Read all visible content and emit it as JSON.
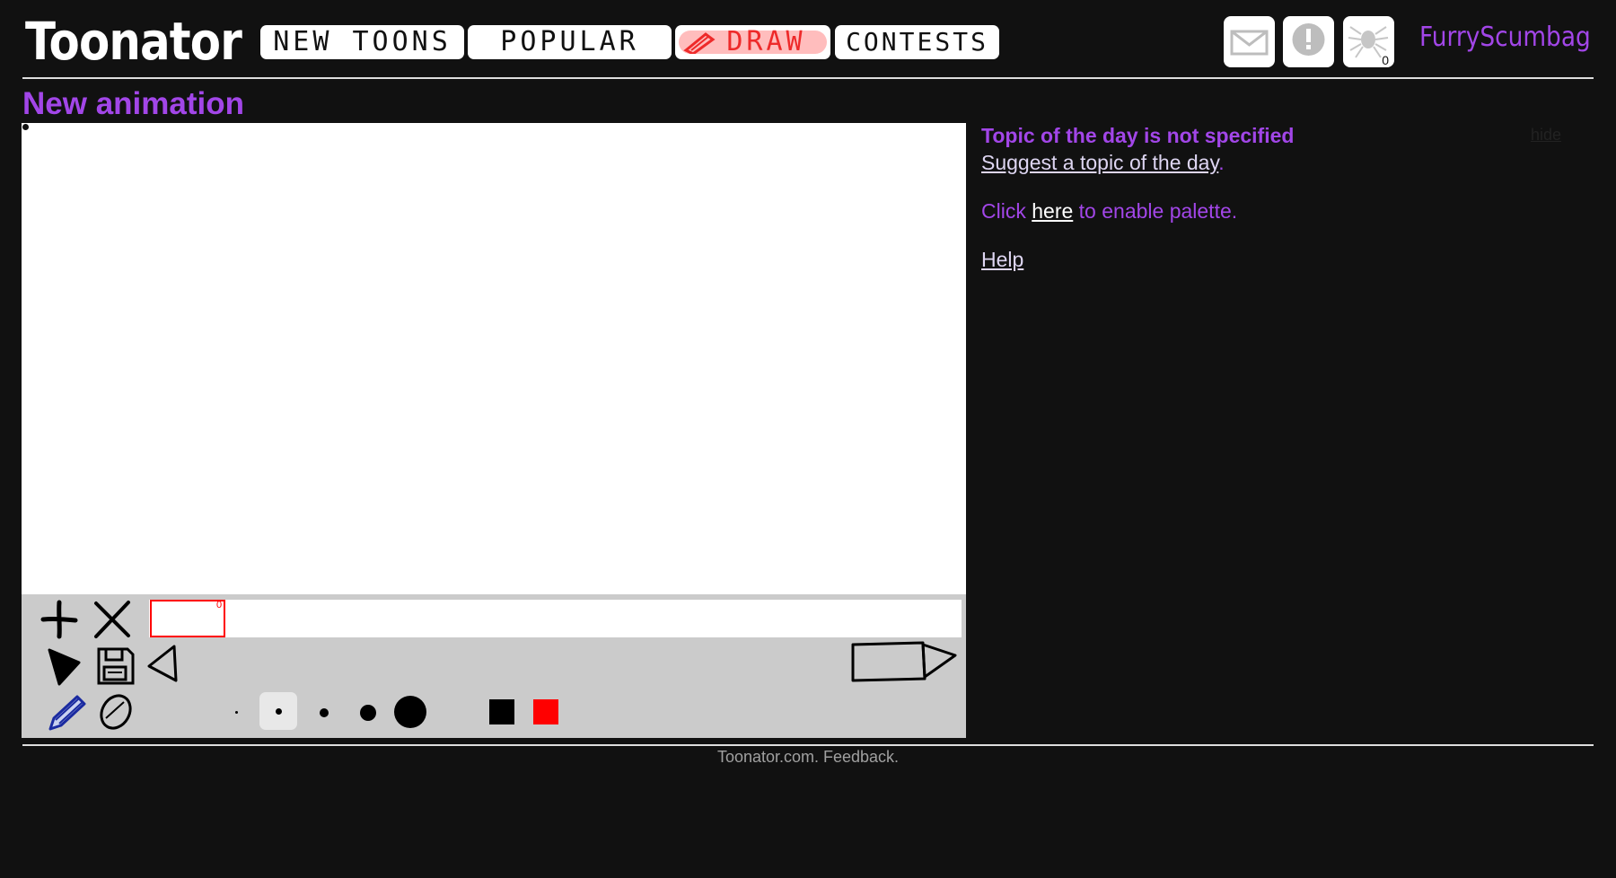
{
  "header": {
    "logo": "Toonator",
    "nav": [
      {
        "id": "new-toons",
        "label": "NEW TOONS"
      },
      {
        "id": "popular",
        "label": "POPULAR"
      },
      {
        "id": "draw",
        "label": "DRAW"
      },
      {
        "id": "contests",
        "label": "CONTESTS"
      }
    ],
    "icons": {
      "messages": "envelope-icon",
      "notifications": "exclamation-icon",
      "spider": "spider-icon",
      "spider_count": "0"
    },
    "username": "FurryScumbag"
  },
  "page": {
    "title": "New animation"
  },
  "editor": {
    "current_frame_number": "0",
    "brush_sizes": [
      "tiny",
      "small",
      "medium",
      "large",
      "huge"
    ],
    "selected_brush_size": "small",
    "colors": {
      "primary": "#000000",
      "secondary": "#ff0000"
    },
    "tools": [
      "add-frame-icon",
      "delete-frame-icon",
      "play-icon",
      "save-icon",
      "prev-frame-icon",
      "next-frame-icon",
      "pencil-icon",
      "eraser-icon"
    ]
  },
  "side": {
    "topic_title": "Topic of the day is not specified",
    "suggest_link": "Suggest a topic of the day",
    "suggest_suffix": ".",
    "palette_prefix": "Click ",
    "palette_link": "here",
    "palette_suffix": " to enable palette.",
    "help_link": "Help",
    "hide_link": "hide"
  },
  "footer": {
    "text": "Toonator.com. Feedback."
  }
}
